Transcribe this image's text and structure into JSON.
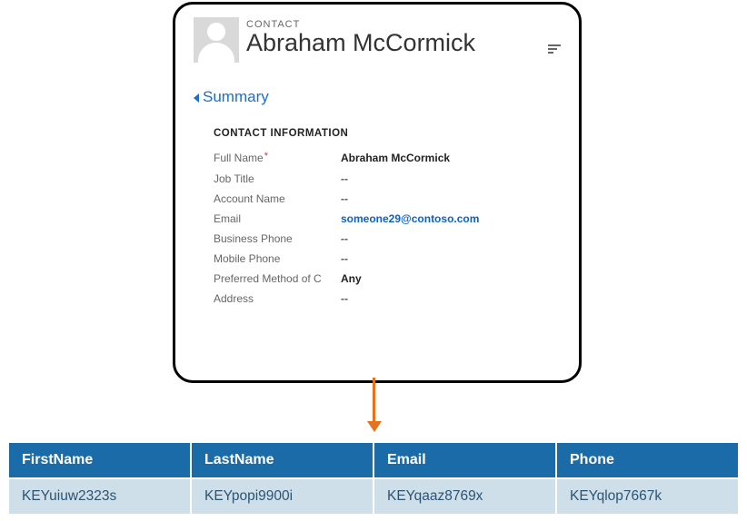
{
  "card": {
    "type_label": "CONTACT",
    "name": "Abraham McCormick",
    "summary_label": "Summary",
    "section_title": "CONTACT INFORMATION",
    "fields": {
      "full_name": {
        "label": "Full Name",
        "value": "Abraham McCormick",
        "required": true
      },
      "job_title": {
        "label": "Job Title",
        "value": "--"
      },
      "account": {
        "label": "Account Name",
        "value": "--"
      },
      "email": {
        "label": "Email",
        "value": "someone29@contoso.com",
        "link": true
      },
      "bus_phone": {
        "label": "Business Phone",
        "value": "--"
      },
      "mob_phone": {
        "label": "Mobile Phone",
        "value": "--"
      },
      "pref_method": {
        "label": "Preferred Method of C",
        "value": "Any"
      },
      "address": {
        "label": "Address",
        "value": "--"
      }
    }
  },
  "table": {
    "headers": [
      "FirstName",
      "LastName",
      "Email",
      "Phone"
    ],
    "row": [
      "KEYuiuw2323s",
      "KEYpopi9900i",
      "KEYqaaz8769x",
      "KEYqlop7667k"
    ]
  }
}
